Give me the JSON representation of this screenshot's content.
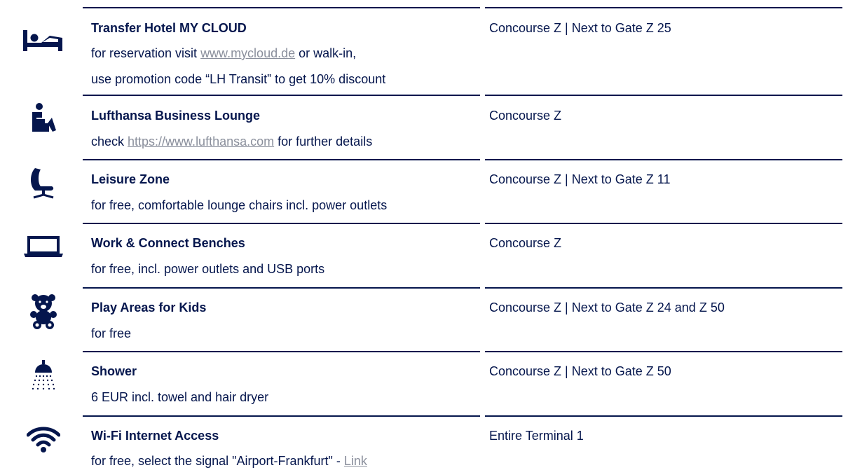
{
  "services": [
    {
      "id": "hotel",
      "icon": "bed-icon",
      "title": "Transfer Hotel MY CLOUD",
      "line1_pre": "for reservation visit ",
      "line1_link": "www.mycloud.de",
      "line1_post": " or walk-in,",
      "line2": "use promotion code “LH Transit” to get 10% discount",
      "location": "Concourse Z | Next to Gate Z 25"
    },
    {
      "id": "lounge",
      "icon": "lounge-seat-icon",
      "title": "Lufthansa Business Lounge",
      "line1_pre": "check ",
      "line1_link": "https://www.lufthansa.com",
      "line1_post": " for further details",
      "location": "Concourse Z"
    },
    {
      "id": "leisure",
      "icon": "egg-chair-icon",
      "title": "Leisure Zone",
      "line1": "for free, comfortable lounge chairs incl. power outlets",
      "location": "Concourse Z | Next to Gate Z 11"
    },
    {
      "id": "work",
      "icon": "laptop-icon",
      "title": "Work & Connect Benches",
      "line1": "for free, incl. power outlets and USB ports",
      "location": "Concourse Z"
    },
    {
      "id": "kids",
      "icon": "teddy-bear-icon",
      "title": "Play Areas for Kids",
      "line1": "for free",
      "location": "Concourse Z | Next to Gate Z 24 and Z 50"
    },
    {
      "id": "shower",
      "icon": "shower-icon",
      "title": "Shower",
      "line1": "6 EUR incl. towel and hair dryer",
      "location": "Concourse Z | Next to Gate Z 50"
    },
    {
      "id": "wifi",
      "icon": "wifi-icon",
      "title": "Wi-Fi Internet Access",
      "line1_pre": "for free, select the signal \"Airport-Frankfurt\" - ",
      "line1_link": "Link",
      "location": "Entire Terminal 1"
    }
  ],
  "colors": {
    "text": "#05164d",
    "link_muted": "#8a8f9c",
    "rule": "#05164d"
  }
}
